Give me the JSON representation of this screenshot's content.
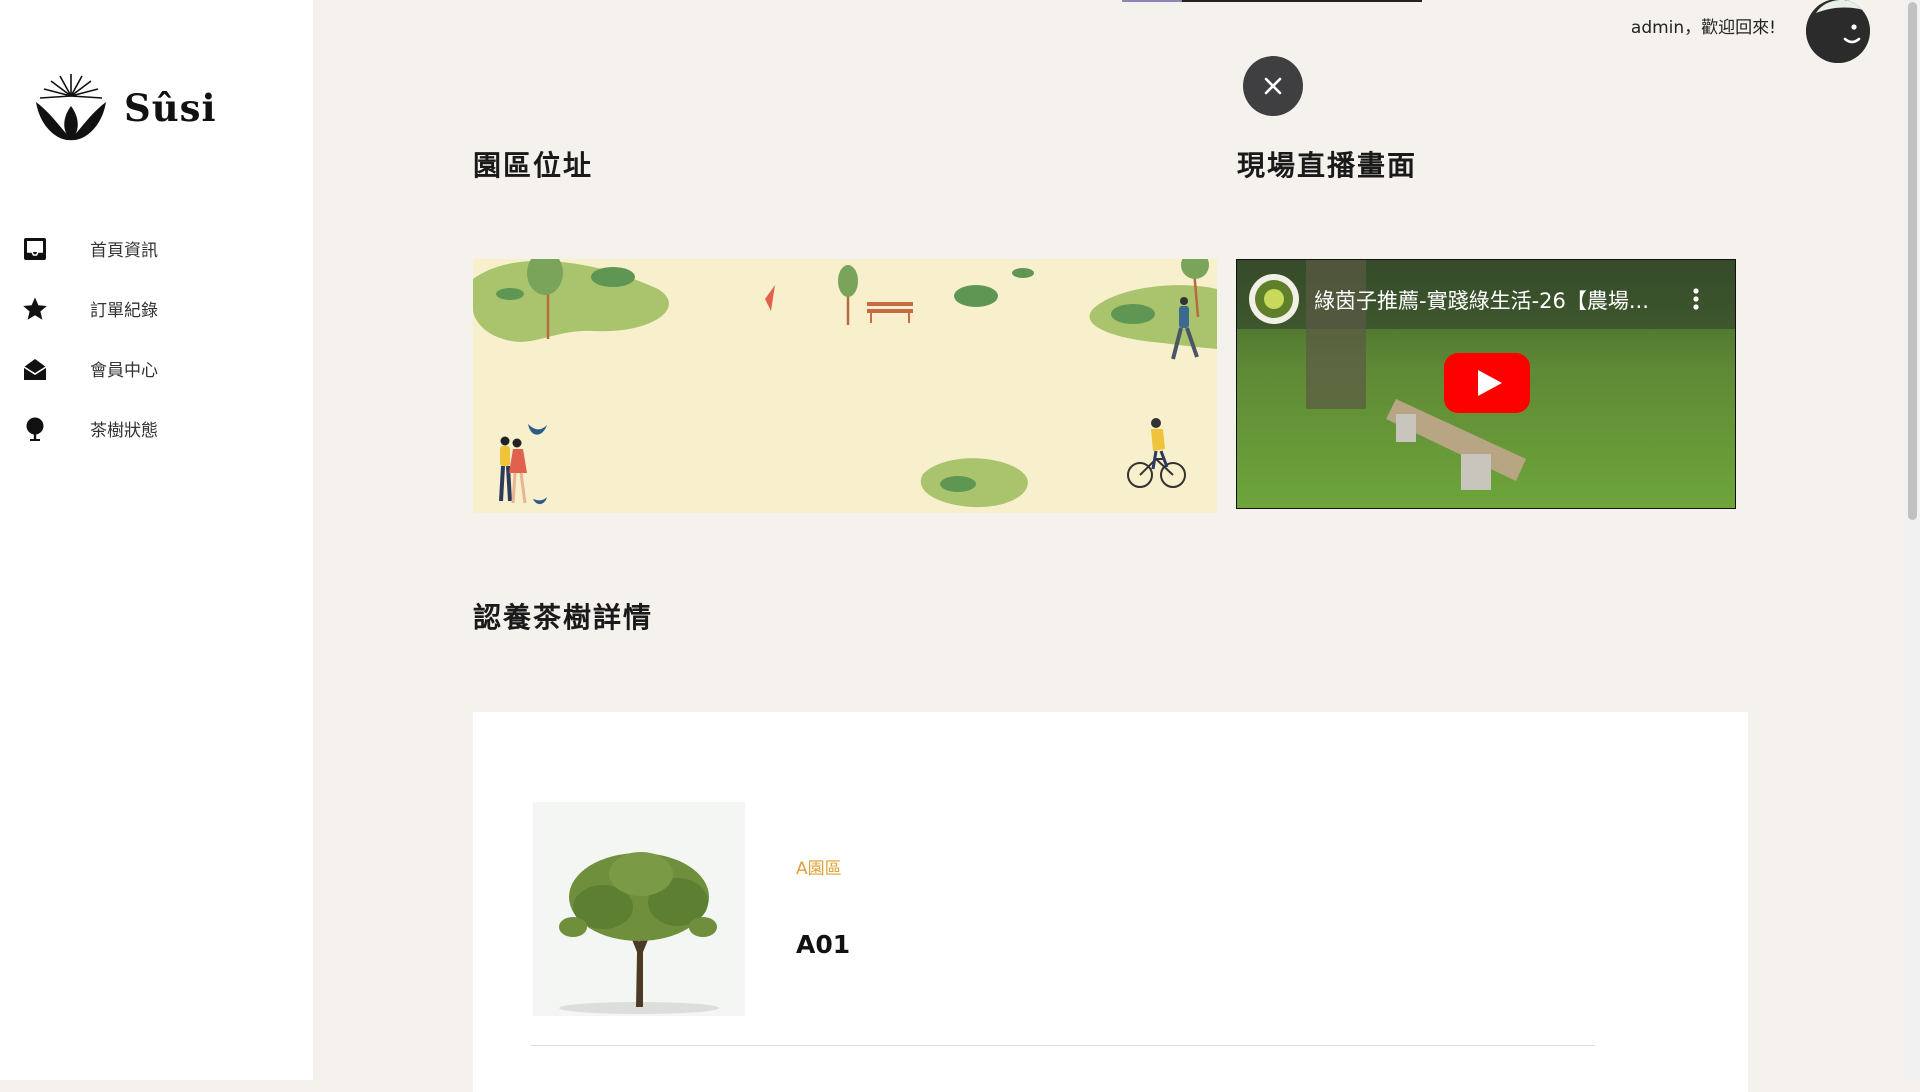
{
  "brand": {
    "name": "Sûsi"
  },
  "sidebar": {
    "items": [
      {
        "label": "首頁資訊",
        "icon": "inbox-icon"
      },
      {
        "label": "訂單紀錄",
        "icon": "star-icon"
      },
      {
        "label": "會員中心",
        "icon": "envelope-open-icon"
      },
      {
        "label": "茶樹狀態",
        "icon": "tree-icon"
      }
    ]
  },
  "header": {
    "greeting": "admin，歡迎回來!",
    "close_icon": "close-icon",
    "avatar_icon": "avatar-icon"
  },
  "sections": {
    "location_title": "園區位址",
    "live_title": "現場直播畫面",
    "detail_title": "認養茶樹詳情"
  },
  "video": {
    "title": "綠茵子推薦-實踐綠生活-26【農場...",
    "play_icon": "youtube-play-icon",
    "menu_icon": "kebab-menu-icon"
  },
  "tree_card": {
    "zone": "A園區",
    "code": "A01"
  },
  "colors": {
    "sidebar_bg": "#ffffff",
    "page_bg": "#f5f1ec",
    "accent": "#e0a034",
    "map_bg": "#f8efcc",
    "map_green": "#a9c46c",
    "youtube_red": "#ff0000"
  }
}
